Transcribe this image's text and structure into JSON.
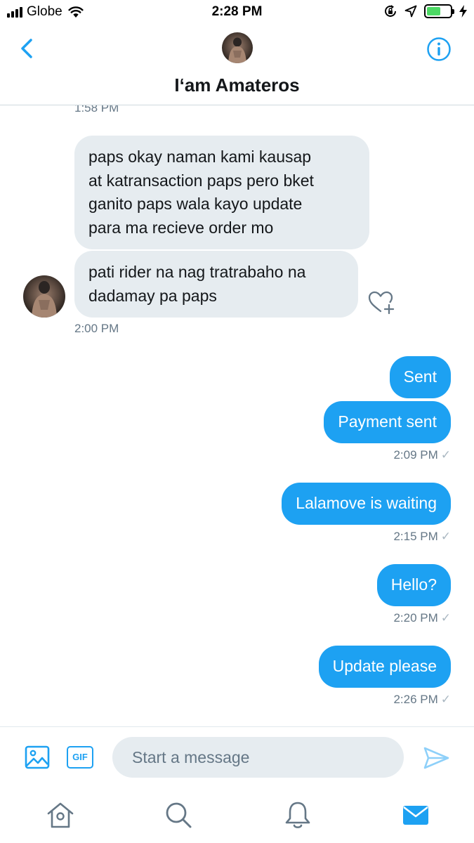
{
  "status_bar": {
    "carrier": "Globe",
    "time": "2:28 PM",
    "battery_level": 0.6,
    "icons": [
      "signal-icon",
      "wifi-icon",
      "rotation-lock-icon",
      "location-icon",
      "battery-icon",
      "charging-icon"
    ]
  },
  "header": {
    "contact_name": "I‘am Amateros",
    "icons": [
      "back-chevron-icon",
      "info-icon"
    ]
  },
  "conversation": {
    "partial_timestamp": "1:58 PM",
    "incoming_messages": [
      {
        "lines": [
          "paps okay naman kami kausap",
          "at katransaction paps pero bket",
          "ganito paps wala kayo update",
          "para ma recieve order mo"
        ]
      },
      {
        "lines": [
          "pati rider na nag tratrabaho na",
          "dadamay pa paps"
        ]
      }
    ],
    "incoming_timestamp": "2:00 PM",
    "outgoing_groups": [
      {
        "messages": [
          "Sent",
          "Payment sent"
        ],
        "timestamp": "2:09 PM",
        "status": "✓"
      },
      {
        "messages": [
          "Lalamove is waiting"
        ],
        "timestamp": "2:15 PM",
        "status": "✓"
      },
      {
        "messages": [
          "Hello?"
        ],
        "timestamp": "2:20 PM",
        "status": "✓"
      },
      {
        "messages": [
          "Update please"
        ],
        "timestamp": "2:26 PM",
        "status": "✓"
      }
    ]
  },
  "composer": {
    "placeholder": "Start a message",
    "gif_label": "GIF",
    "icons": [
      "image-icon",
      "send-icon"
    ]
  },
  "tab_bar": {
    "tabs": [
      "home",
      "search",
      "notifications",
      "messages"
    ],
    "active": "messages"
  },
  "colors": {
    "accent": "#1da1f2",
    "incoming_bubble": "#e6ecf0",
    "timestamp_text": "#657786",
    "tab_inactive": "#657786"
  }
}
